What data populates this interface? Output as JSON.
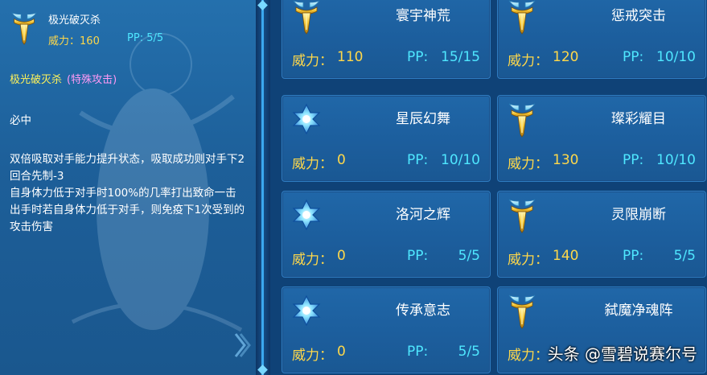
{
  "detail": {
    "name": "极光破灭杀",
    "power_label": "威力",
    "power_value": "160",
    "pp_label": "PP",
    "pp_value": "5/5",
    "title": "极光破灭杀",
    "category": "(特殊攻击)",
    "effect_1": "必中",
    "effect_2": "双倍吸取对手能力提升状态，吸取成功则对手下2回合先制-3",
    "effect_3": "自身体力低于对手时100%的几率打出致命一击",
    "effect_4": "出手时若自身体力低于对手，则免疫下1次受到的攻击伤害",
    "colors": {
      "name": "#ffffff",
      "power": "#ffd84a",
      "pp": "#4fe7ff",
      "title": "#fff35a",
      "category": "#ff9af5"
    }
  },
  "skills": [
    {
      "name": "寰宇神荒",
      "icon": "winged-gold-emblem-icon",
      "power_label": "威力：",
      "power": "110",
      "pp_label": "PP:",
      "pp": "15/15"
    },
    {
      "name": "惩戒突击",
      "icon": "winged-gold-emblem-icon",
      "power_label": "威力：",
      "power": "120",
      "pp_label": "PP:",
      "pp": "10/10"
    },
    {
      "name": "星辰幻舞",
      "icon": "blue-star-icon",
      "power_label": "威力：",
      "power": "0",
      "pp_label": "PP:",
      "pp": "10/10"
    },
    {
      "name": "璨彩耀目",
      "icon": "winged-gold-emblem-icon",
      "power_label": "威力：",
      "power": "130",
      "pp_label": "PP:",
      "pp": "10/10"
    },
    {
      "name": "洛河之辉",
      "icon": "blue-star-icon",
      "power_label": "威力：",
      "power": "0",
      "pp_label": "PP:",
      "pp": "5/5"
    },
    {
      "name": "灵限崩断",
      "icon": "winged-gold-emblem-icon",
      "power_label": "威力：",
      "power": "140",
      "pp_label": "PP:",
      "pp": "5/5"
    },
    {
      "name": "传承意志",
      "icon": "blue-star-icon",
      "power_label": "威力：",
      "power": "0",
      "pp_label": "PP:",
      "pp": "5/5"
    },
    {
      "name": "弑魔净魂阵",
      "icon": "winged-gold-emblem-icon",
      "power_label": "威力：",
      "power": "",
      "pp_label": "",
      "pp": ""
    }
  ],
  "watermark": "头条 @雪碧说赛尔号"
}
